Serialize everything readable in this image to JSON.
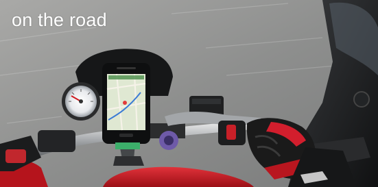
{
  "caption": {
    "text": "on the road"
  },
  "photo": {
    "subject": "motorcycle-with-smartphone-mount"
  },
  "colors": {
    "caption_text": "#ffffff",
    "road": "#8f9090",
    "fuel_tank": "#c8141e",
    "glove": "#1a1a1a",
    "glove_accent": "#d21e2d",
    "phone_screen": "#dfe8d2"
  }
}
